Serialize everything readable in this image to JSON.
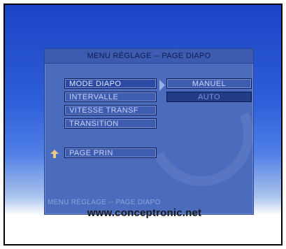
{
  "menu": {
    "title": "MENU RÉGLAGE -- PAGE DIAPO",
    "items": [
      {
        "label": "MODE DIAPO"
      },
      {
        "label": "INTERVALLE"
      },
      {
        "label": "VITESSE TRANSF"
      },
      {
        "label": "TRANSITION"
      }
    ],
    "page_prin": "PAGE PRIN",
    "options": [
      {
        "label": "MANUEL"
      },
      {
        "label": "AUTO"
      }
    ],
    "status": "MENU RÉGLAGE -- PAGE DIAPO"
  },
  "footer": {
    "url": "www.conceptronic.net"
  },
  "colors": {
    "background_top": "#1b44c4",
    "panel": "#4b6bbd",
    "selected": "#2c4aa2"
  }
}
